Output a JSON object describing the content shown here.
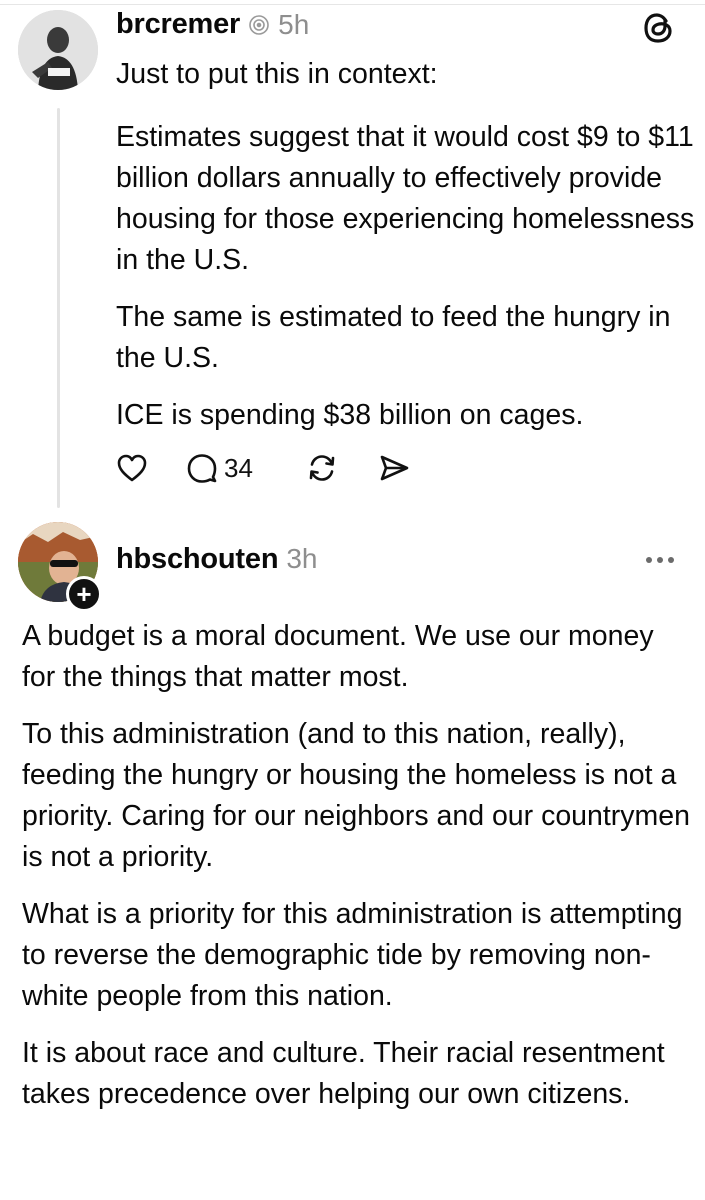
{
  "post1": {
    "username": "brcremer",
    "time": "5h",
    "paragraphs": [
      "Just to put this in context:",
      "Estimates suggest that it would cost $9 to $11 billion dollars annually to effectively provide housing for those experiencing homelessness in the U.S.",
      "The same is estimated to feed the hungry in the U.S.",
      "ICE is spending $38 billion on cages."
    ],
    "reply_count": "34",
    "icons": [
      "heart-icon",
      "comment-icon",
      "repost-icon",
      "share-icon",
      "threads-logo",
      "verified-icon"
    ]
  },
  "post2": {
    "username": "hbschouten",
    "time": "3h",
    "follow_symbol": "+",
    "paragraphs": [
      "A budget is a moral document. We use our money for the things that matter most.",
      "To this administration (and to this nation, really), feeding the hungry or housing the homeless is not a priority. Caring for our neighbors and our countrymen is not a priority.",
      "What is a priority for this administration is attempting to reverse the demographic tide by removing non-white people from this nation.",
      "It is about race and culture. Their racial resentment takes precedence over helping our own citizens."
    ]
  }
}
